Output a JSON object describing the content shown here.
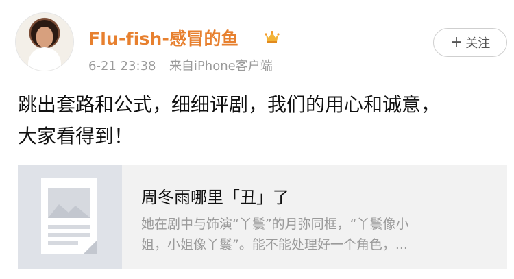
{
  "user": {
    "name": "Flu-fish-感冒的鱼",
    "badge_icon": "crown-icon",
    "accent_color": "#e7802f"
  },
  "post": {
    "date": "6-21",
    "time": "23:38",
    "source": "来自iPhone客户端",
    "text_line1": "跳出套路和公式，细细评剧，我们的用心和诚意，",
    "text_line2": "大家看得到！"
  },
  "follow_button": {
    "plus": "+",
    "label": "关注"
  },
  "link_card": {
    "thumbnail_icon": "article-thumbnail-icon",
    "title": "周冬雨哪里「丑」了",
    "desc_line1": "她在剧中与饰演“丫鬟”的月弥同框，“丫鬟像小",
    "desc_line2": "姐，小姐像丫鬟”。能不能处理好一个角色，..."
  }
}
